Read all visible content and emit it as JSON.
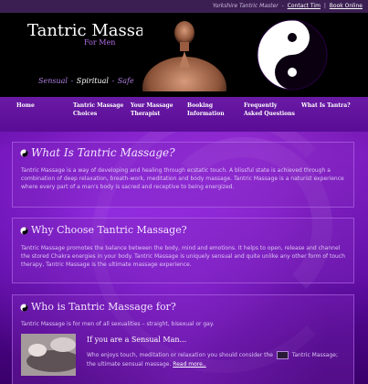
{
  "topbar": {
    "site_name": "Yorkshire Tantric Master",
    "contact_link": "Contact Tim",
    "separator": "|",
    "book_link": "Book Online"
  },
  "header": {
    "title": "Tantric Massage",
    "subtitle": "For Men",
    "tagline": {
      "part1": "Sensual",
      "part2": "Spiritual",
      "part3": "Safe",
      "dash": "-"
    }
  },
  "nav": {
    "items": [
      {
        "label": "Home"
      },
      {
        "label": "Tantric Massage\nChoices"
      },
      {
        "label": "Your Massage\nTherapist"
      },
      {
        "label": "Booking\nInformation"
      },
      {
        "label": "Frequently\nAsked Questions"
      },
      {
        "label": "What Is Tantra?"
      }
    ]
  },
  "sections": {
    "what": {
      "title": "What Is Tantric Massage?",
      "body": "Tantric Massage is a way of developing and healing through ecstatic touch. A blissful state is achieved through a combination of deep relaxation, breath-work, meditation and body massage. Tantric Massage is a naturist experience where every part of a man's body is sacred and receptive to being energized."
    },
    "why": {
      "title": "Why Choose Tantric Massage?",
      "body": "Tantric Massage promotes the balance between the body, mind and emotions. It helps to open, release and channel the stored Chakra energies in your body. Tantric Massage is uniquely sensual and quite unlike any other form of touch therapy, Tantric Massage is the ultimate massage experience."
    },
    "who": {
      "title": "Who is Tantric Massage for?",
      "intro": "Tantric Massage is for men of all sexualities – straight, bisexual or gay.",
      "sub_title": "If you are a Sensual Man...",
      "sub_body_before": "Who enjoys touch, meditation or relaxation you should consider the",
      "sub_body_after": "Tantric Massage; the ultimate sensual massage.",
      "read_more": "Read more.."
    }
  },
  "colors": {
    "accent": "#b06ee6",
    "background": "#5a0aa0",
    "header_bg": "#000000"
  }
}
